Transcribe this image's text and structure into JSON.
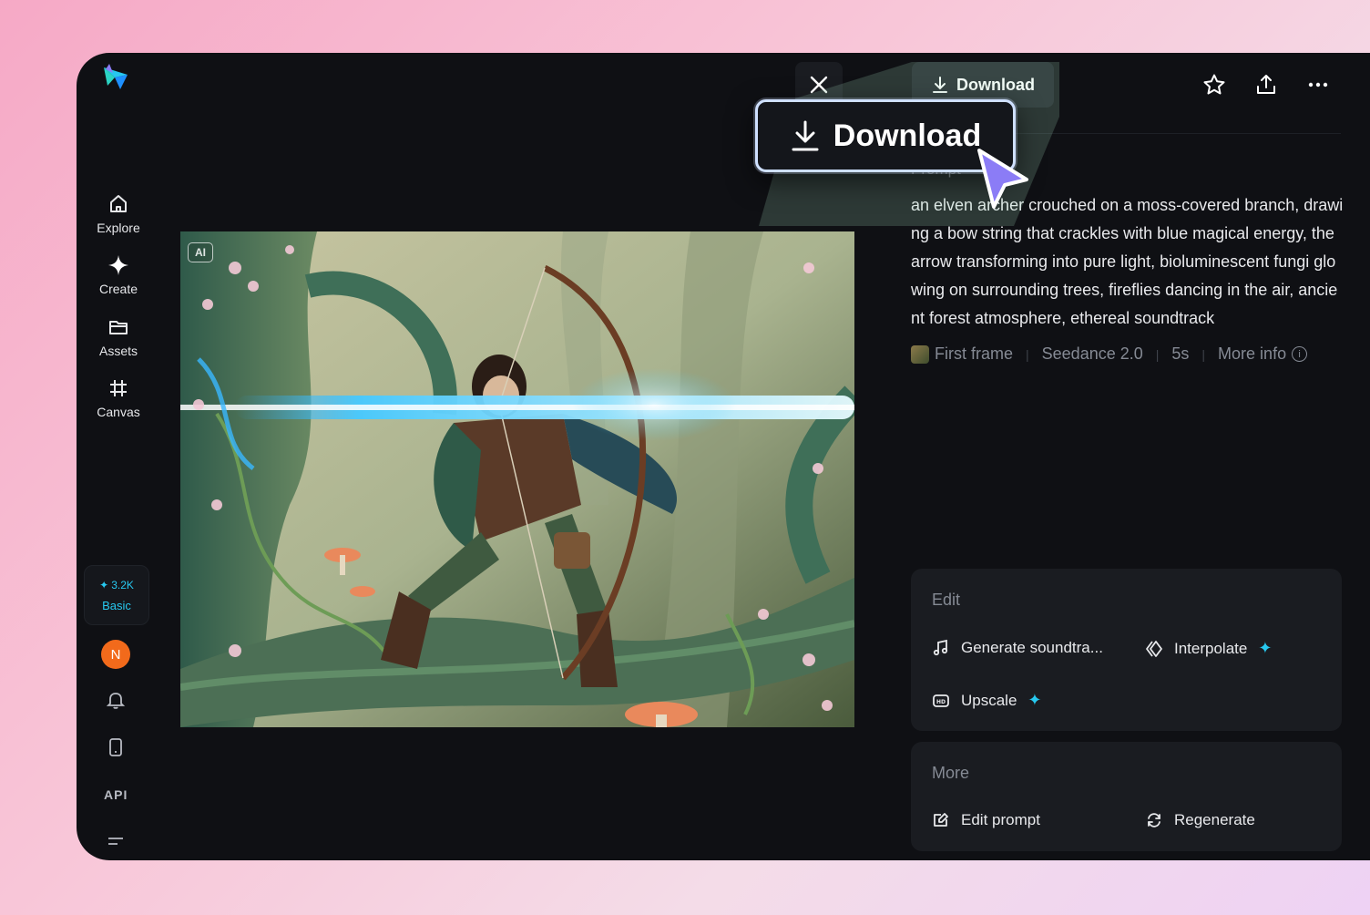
{
  "sidebar": {
    "items": [
      {
        "label": "Explore",
        "icon": "home-icon"
      },
      {
        "label": "Create",
        "icon": "sparkle-icon"
      },
      {
        "label": "Assets",
        "icon": "folder-icon"
      },
      {
        "label": "Canvas",
        "icon": "hash-frame-icon"
      }
    ],
    "credits": {
      "amount": "3.2K",
      "tier": "Basic"
    },
    "avatar_initial": "N",
    "api_label": "API"
  },
  "topbar": {
    "download_label": "Download",
    "callout_download_label": "Download"
  },
  "image": {
    "badge": "AI"
  },
  "details": {
    "prompt_label": "Prompt",
    "prompt_text": "an elven archer crouched on a moss-covered branch, drawing a bow string that crackles with blue magical energy, the arrow transforming into pure light, bioluminescent fungi glowing on surrounding trees, fireflies dancing in the air, ancient forest atmosphere, ethereal soundtrack",
    "meta": {
      "reference": "First frame",
      "model": "Seedance 2.0",
      "duration": "5s",
      "more_info": "More info"
    }
  },
  "edit_card": {
    "title": "Edit",
    "actions": [
      {
        "label": "Generate soundtra...",
        "icon": "music-note-icon",
        "premium": false
      },
      {
        "label": "Interpolate",
        "icon": "interpolate-icon",
        "premium": true
      },
      {
        "label": "Upscale",
        "icon": "hd-icon",
        "premium": true
      }
    ]
  },
  "more_card": {
    "title": "More",
    "actions": [
      {
        "label": "Edit prompt",
        "icon": "edit-prompt-icon"
      },
      {
        "label": "Regenerate",
        "icon": "regenerate-icon"
      }
    ]
  },
  "colors": {
    "app_bg": "#0f1014",
    "card_bg": "#1a1c21",
    "accent": "#27c8ef",
    "avatar": "#f26a1b",
    "callout_border": "#cfe0ff",
    "cursor": "#8b7cf6"
  }
}
